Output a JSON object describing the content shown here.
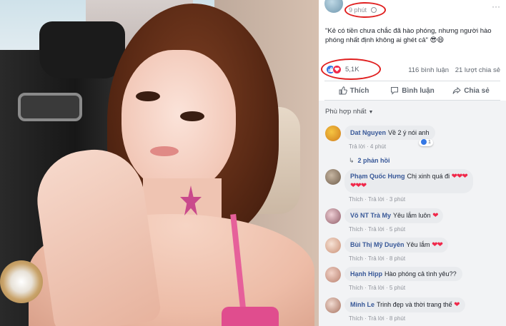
{
  "post": {
    "time": "9 phút",
    "text": "\"Kẻ có tiền chưa chắc đã hào phóng, nhưng người hào phóng nhất định không ai ghét cả\" 😎😄",
    "reaction_count": "5,1K",
    "comments_count": "116 bình luận",
    "shares_count": "21 lượt chia sẻ",
    "actions": {
      "like": "Thích",
      "comment": "Bình luận",
      "share": "Chia sẻ"
    },
    "sort_label": "Phù hợp nhất"
  },
  "comments": [
    {
      "name": "Dat Nguyen",
      "text": "Về 2 ý nói anh",
      "reply": "Trả lời",
      "time": "4 phút",
      "likes": "1",
      "replies_label": "2 phản hồi"
    },
    {
      "name": "Phạm Quốc Hưng",
      "text": "Chị xinh quá đi",
      "hearts": "❤❤❤❤❤❤",
      "like": "Thích",
      "reply": "Trả lời",
      "time": "3 phút"
    },
    {
      "name": "Võ NT Trà My",
      "text": "Yêu lắm luôn",
      "hearts": "❤",
      "like": "Thích",
      "reply": "Trả lời",
      "time": "5 phút"
    },
    {
      "name": "Bùi Thị Mỹ Duyên",
      "text": "Yêu lắm",
      "hearts": "❤❤",
      "like": "Thích",
      "reply": "Trả lời",
      "time": "8 phút"
    },
    {
      "name": "Hạnh Hipp",
      "text": "Hào phóng cả tình yêu??",
      "like": "Thích",
      "reply": "Trả lời",
      "time": "5 phút"
    },
    {
      "name": "Minh Le",
      "text": "Trinh đẹp và thời trang thế",
      "hearts": "❤",
      "like": "Thích",
      "reply": "Trả lời",
      "time": "8 phút"
    }
  ],
  "colors": {
    "link": "#385898",
    "like_blue": "#3578e5",
    "love_red": "#f0284a",
    "annotation_red": "#e02020"
  },
  "icons": [
    "globe-icon",
    "like-icon",
    "love-icon",
    "thumb-up-icon",
    "comment-icon",
    "share-icon",
    "chevron-down-icon",
    "reply-arrow-icon"
  ]
}
